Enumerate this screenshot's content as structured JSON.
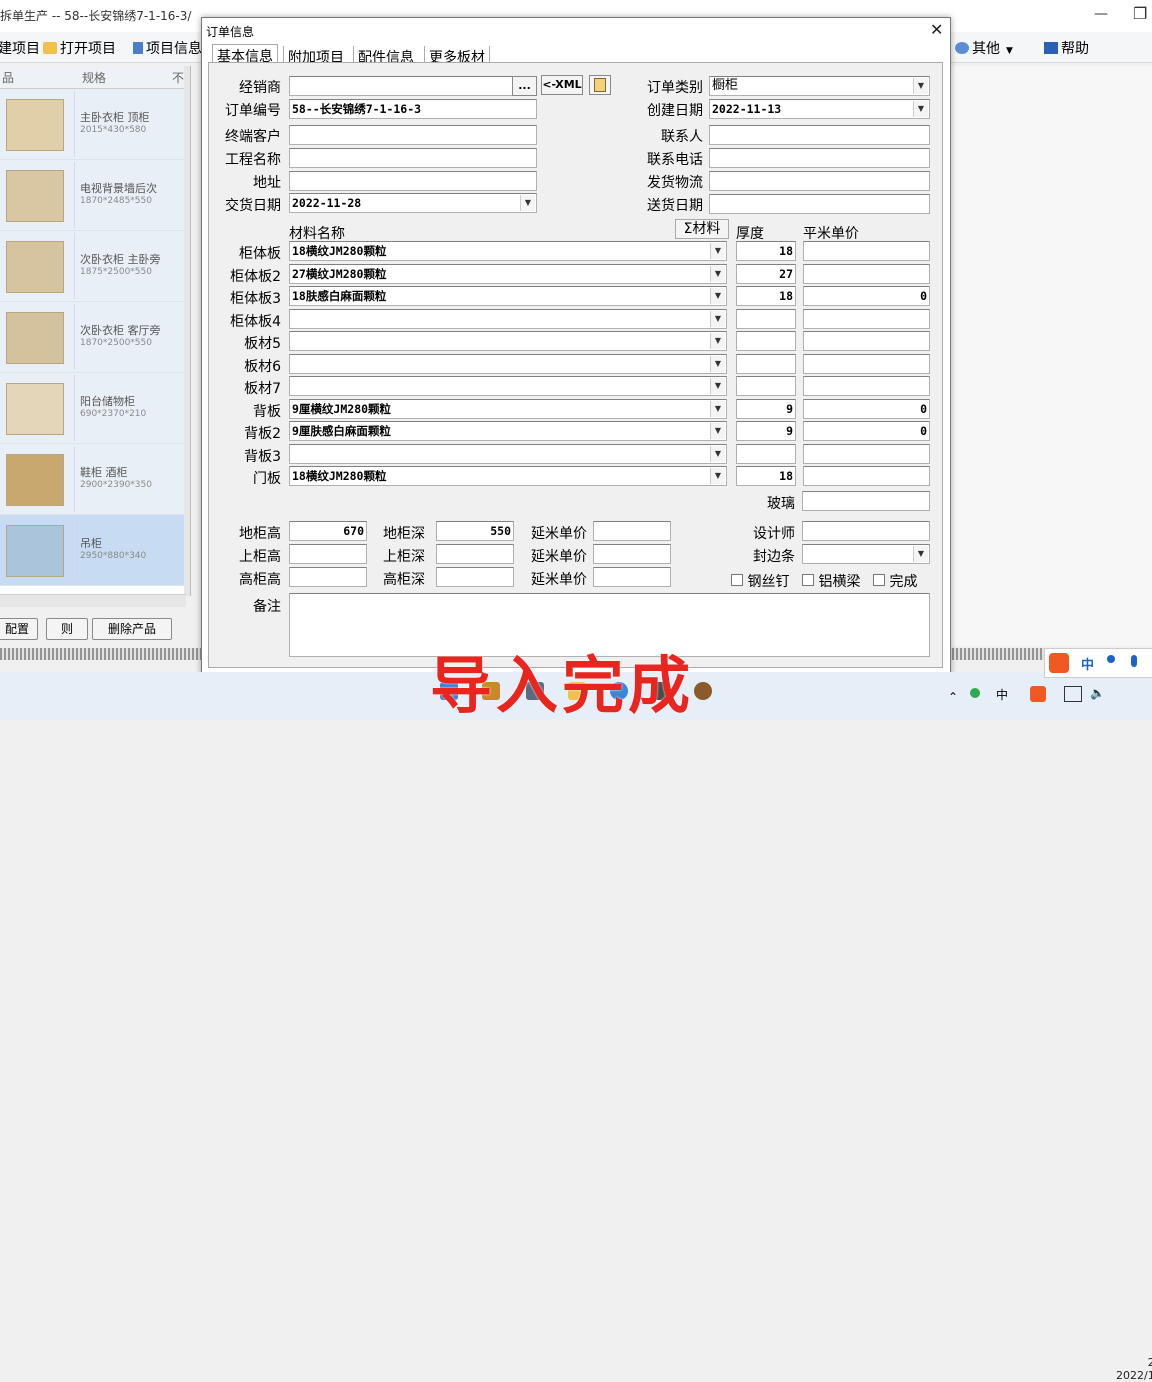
{
  "app": {
    "title": "拆单生产 -- 58--长安锦绣7-1-16-3/",
    "toolbar": {
      "new_project": "建项目",
      "open_project": "打开项目",
      "project_info": "项目信息",
      "other": "其他",
      "help": "帮助"
    }
  },
  "product_list": {
    "headers": [
      "品",
      "规格",
      "不"
    ],
    "items": [
      {
        "name": "主卧衣柜 顶柜",
        "size": "2015*430*580"
      },
      {
        "name": "电视背景墙后次",
        "size": "1870*2485*550"
      },
      {
        "name": "次卧衣柜 主卧旁",
        "size": "1875*2500*550"
      },
      {
        "name": "次卧衣柜 客厅旁",
        "size": "1870*2500*550"
      },
      {
        "name": "阳台储物柜",
        "size": "690*2370*210"
      },
      {
        "name": "鞋柜 酒柜",
        "size": "2900*2390*350"
      },
      {
        "name": "吊柜",
        "size": "2950*880*340"
      }
    ],
    "buttons": {
      "config": "配置",
      "rule": "则",
      "delete": "删除产品"
    }
  },
  "dialog": {
    "title": "订单信息",
    "tabs": [
      "基本信息",
      "附加项目",
      "配件信息",
      "更多板材"
    ],
    "labels": {
      "dealer": "经销商",
      "order_no": "订单编号",
      "end_customer": "终端客户",
      "project_name": "工程名称",
      "address": "地址",
      "delivery_date": "交货日期",
      "order_type": "订单类别",
      "created_date": "创建日期",
      "contact": "联系人",
      "phone": "联系电话",
      "logistics": "发货物流",
      "ship_date": "送货日期",
      "material_name": "材料名称",
      "sigma_material": "Σ材料",
      "thickness": "厚度",
      "sqm_price": "平米单价",
      "glass": "玻璃",
      "base_height": "地柜高",
      "base_depth": "地柜深",
      "upper_height": "上柜高",
      "upper_depth": "上柜深",
      "tall_height": "高柜高",
      "tall_depth": "高柜深",
      "linear_price": "延米单价",
      "designer": "设计师",
      "edge_band": "封边条",
      "steel_nail": "钢丝钉",
      "alu_beam": "铝横梁",
      "done": "完成",
      "remark": "备注"
    },
    "values": {
      "dealer": "",
      "order_no": "58--长安锦绣7-1-16-3",
      "delivery_date": "2022-11-28",
      "order_type": "橱柜",
      "created_date": "2022-11-13",
      "base_height": "670",
      "base_depth": "550"
    },
    "buttons": {
      "dots": "...",
      "xml": "<-XML"
    },
    "materials": [
      {
        "label": "柜体板",
        "name": "18横纹JM280颗粒",
        "thickness": "18",
        "price": ""
      },
      {
        "label": "柜体板2",
        "name": "27横纹JM280颗粒",
        "thickness": "27",
        "price": ""
      },
      {
        "label": "柜体板3",
        "name": "18肤感白麻面颗粒",
        "thickness": "18",
        "price": "0"
      },
      {
        "label": "柜体板4",
        "name": "",
        "thickness": "",
        "price": ""
      },
      {
        "label": "板材5",
        "name": "",
        "thickness": "",
        "price": ""
      },
      {
        "label": "板材6",
        "name": "",
        "thickness": "",
        "price": ""
      },
      {
        "label": "板材7",
        "name": "",
        "thickness": "",
        "price": ""
      },
      {
        "label": "背板",
        "name": "9厘横纹JM280颗粒",
        "thickness": "9",
        "price": "0"
      },
      {
        "label": "背板2",
        "name": "9厘肤感白麻面颗粒",
        "thickness": "9",
        "price": "0"
      },
      {
        "label": "背板3",
        "name": "",
        "thickness": "",
        "price": ""
      },
      {
        "label": "门板",
        "name": "18横纹JM280颗粒",
        "thickness": "18",
        "price": ""
      }
    ]
  },
  "overlay_text": "导入完成",
  "tray": {
    "time_line1": "2",
    "time_line2": "2022/1",
    "ime_lang": "中"
  }
}
